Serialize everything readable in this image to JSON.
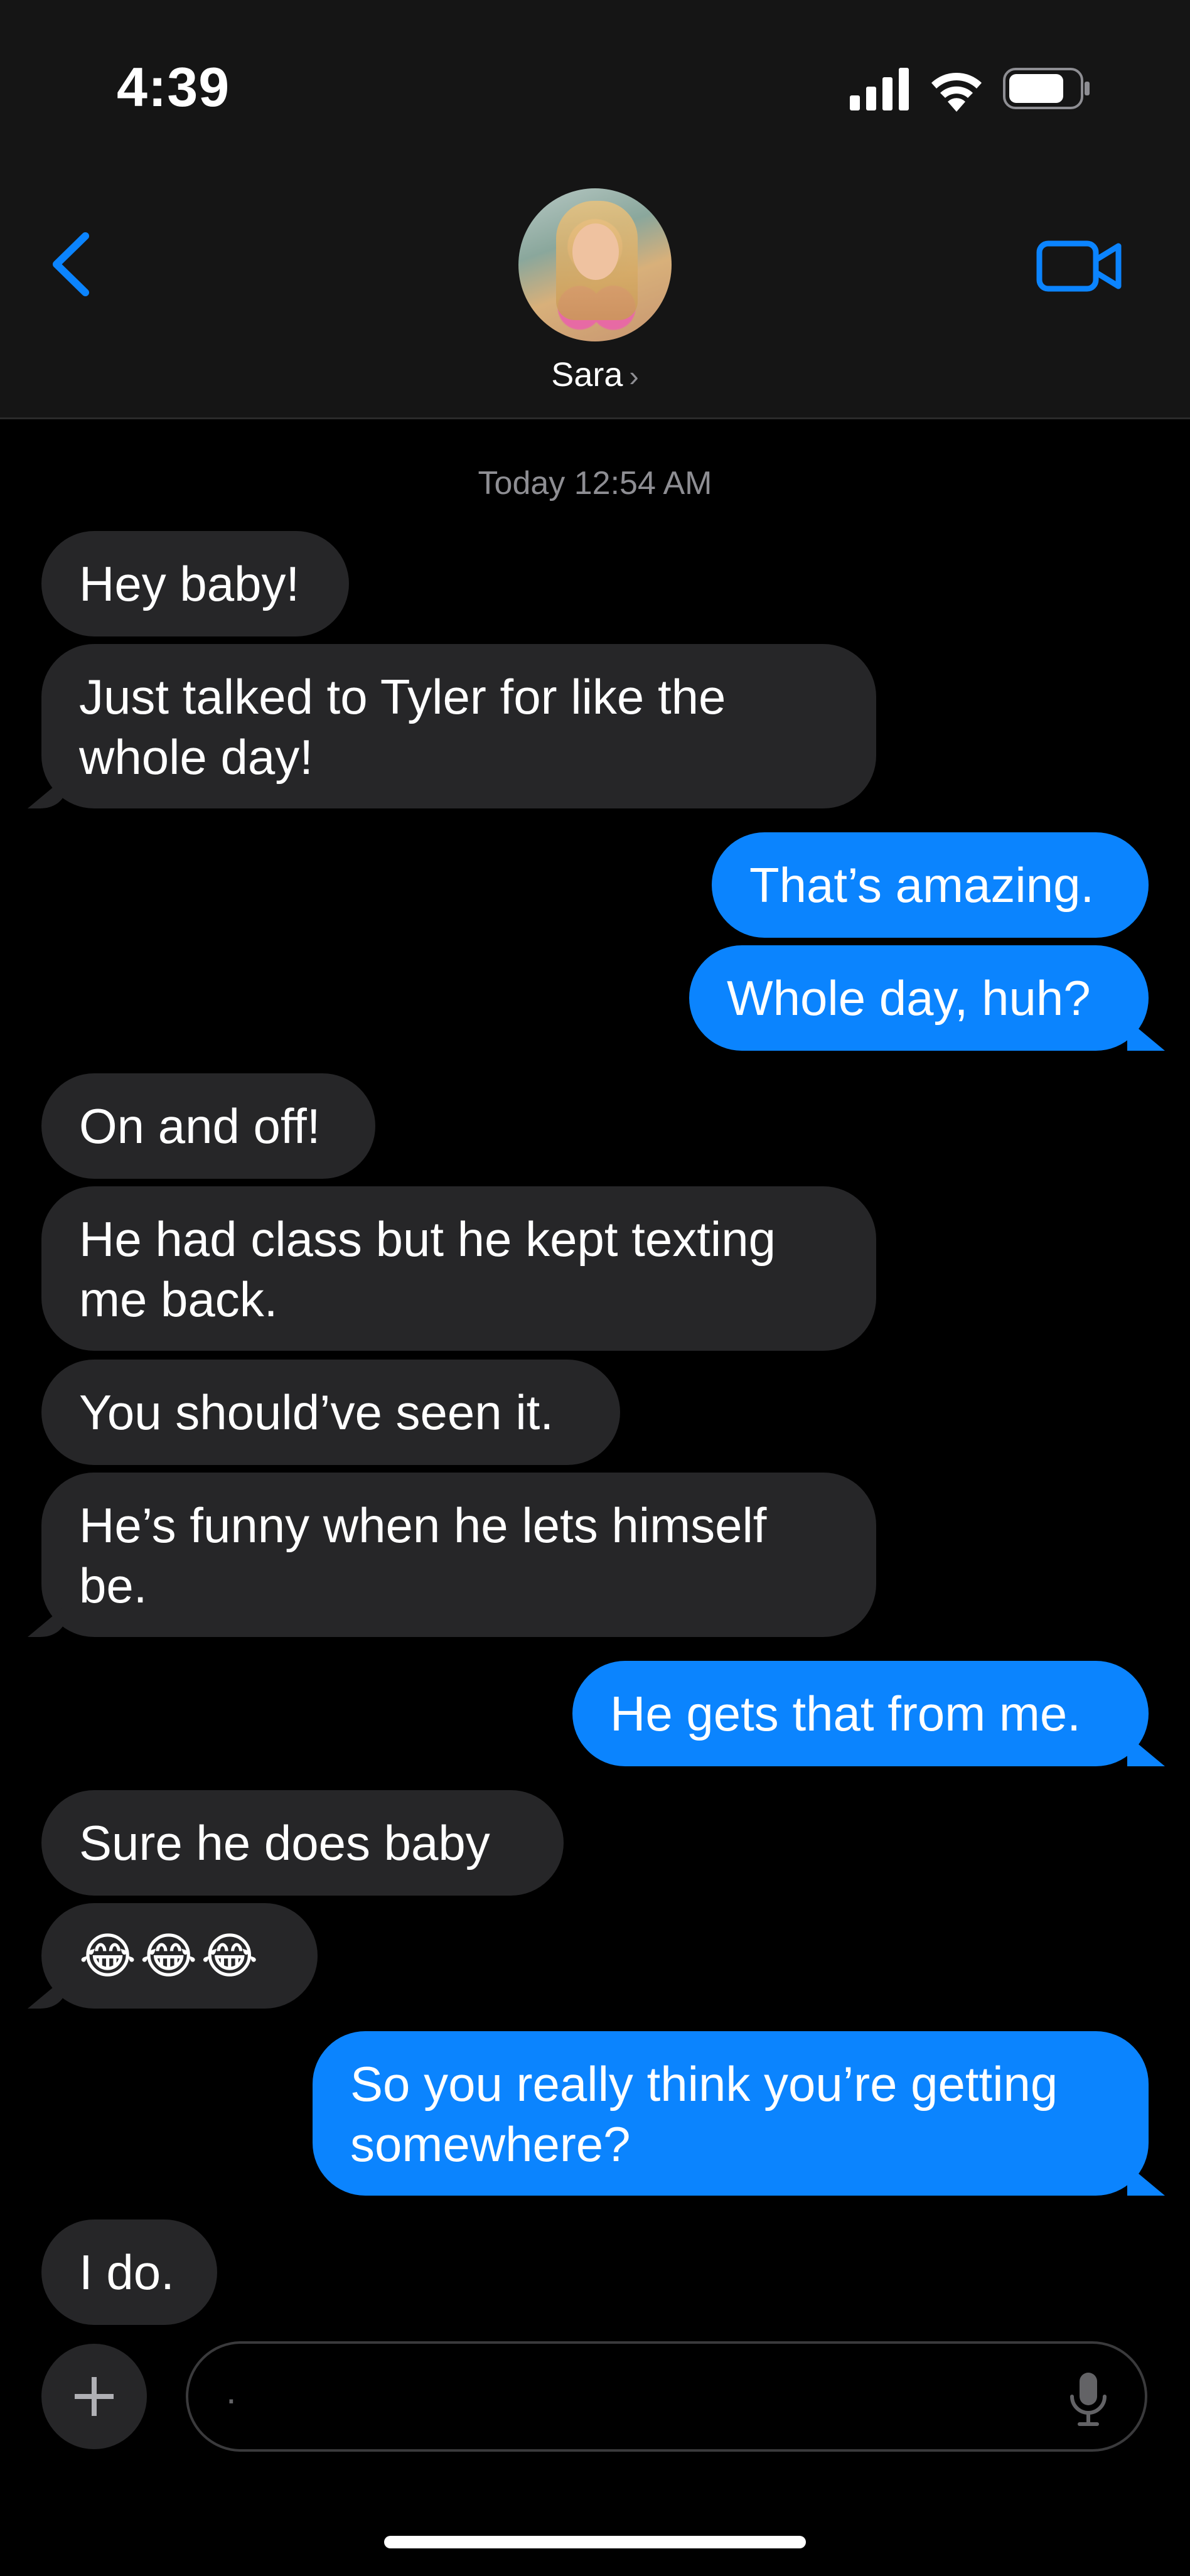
{
  "status_bar": {
    "time": "4:39"
  },
  "header": {
    "contact_name": "Sara",
    "chevron": "›",
    "back_icon": "chevron-left-icon",
    "video_icon": "video-camera-icon",
    "accent_color": "#0B84FE"
  },
  "timestamp": "Today 12:54 AM",
  "messages": [
    {
      "from": "them",
      "text": "Hey baby!"
    },
    {
      "from": "them",
      "text": "Just talked to Tyler for like the whole day!"
    },
    {
      "from": "me",
      "text": "That’s amazing."
    },
    {
      "from": "me",
      "text": "Whole day, huh?"
    },
    {
      "from": "them",
      "text": "On and off!"
    },
    {
      "from": "them",
      "text": "He had class but he kept texting me back."
    },
    {
      "from": "them",
      "text": "You should’ve seen it."
    },
    {
      "from": "them",
      "text": "He’s funny when he lets himself be."
    },
    {
      "from": "me",
      "text": "He gets that from me."
    },
    {
      "from": "them",
      "text": "Sure he does baby"
    },
    {
      "from": "them",
      "text": "😂😂😂"
    },
    {
      "from": "me",
      "text": "So you really think you’re getting somewhere?"
    },
    {
      "from": "them",
      "text": "I do."
    }
  ],
  "composer": {
    "value": "."
  }
}
